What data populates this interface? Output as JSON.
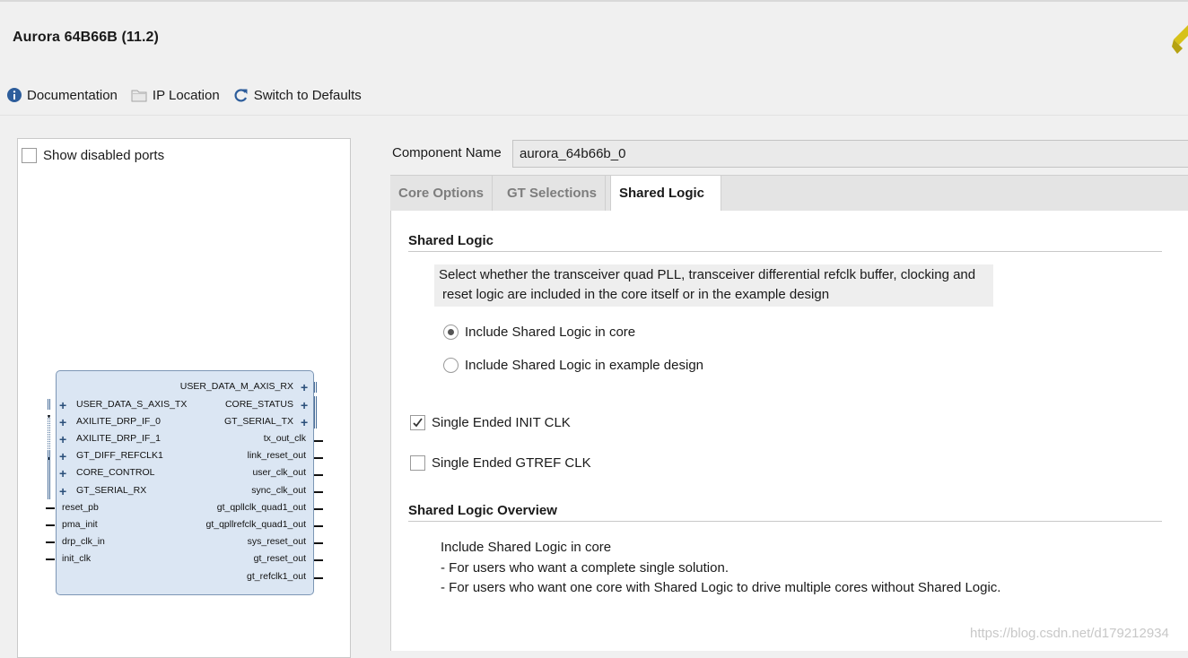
{
  "app": {
    "title": "Aurora 64B66B (11.2)"
  },
  "toolbar": {
    "documentation": "Documentation",
    "ip_location": "IP Location",
    "switch_defaults": "Switch to Defaults"
  },
  "left": {
    "show_disabled_ports": "Show disabled ports",
    "show_disabled_checked": false,
    "block": {
      "left_ports": [
        "USER_DATA_S_AXIS_TX",
        "AXILITE_DRP_IF_0",
        "AXILITE_DRP_IF_1",
        "GT_DIFF_REFCLK1",
        "CORE_CONTROL",
        "GT_SERIAL_RX"
      ],
      "left_wires": [
        "reset_pb",
        "pma_init",
        "drp_clk_in",
        "init_clk"
      ],
      "right_bus_ports": [
        "USER_DATA_M_AXIS_RX",
        "CORE_STATUS",
        "GT_SERIAL_TX"
      ],
      "right_wires": [
        "tx_out_clk",
        "link_reset_out",
        "user_clk_out",
        "sync_clk_out",
        "gt_qpllclk_quad1_out",
        "gt_qpllrefclk_quad1_out",
        "sys_reset_out",
        "gt_reset_out",
        "gt_refclk1_out"
      ]
    }
  },
  "component": {
    "label": "Component Name",
    "value": "aurora_64b66b_0"
  },
  "tabs": [
    "Core Options",
    "GT Selections",
    "Shared Logic"
  ],
  "active_tab": "Shared Logic",
  "shared_logic": {
    "section_title": "Shared Logic",
    "note_line1": "Select whether the transceiver quad PLL, transceiver differential refclk buffer, clocking and",
    "note_line2": "reset logic are included in the core itself or in the example design",
    "radio_core": "Include Shared Logic in core",
    "radio_example": "Include Shared Logic in example design",
    "selected": "core",
    "init_clk_label": "Single Ended INIT CLK",
    "init_clk_checked": true,
    "gtref_clk_label": "Single Ended GTREF CLK",
    "gtref_clk_checked": false
  },
  "overview": {
    "section_title": "Shared Logic Overview",
    "lines": [
      "Include Shared Logic in core",
      "- For users who want a complete single solution.",
      "- For users who want one core with Shared Logic to drive multiple cores without Shared Logic."
    ]
  },
  "watermark": "https://blog.csdn.net/d179212934",
  "colors": {
    "accent_blue": "#2d6ab4",
    "block_fill": "#dbe6f3",
    "logo": "#c8b400"
  }
}
